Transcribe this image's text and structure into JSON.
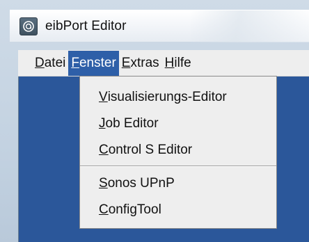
{
  "window": {
    "title": "eibPort Editor",
    "icon": "app-logo-icon"
  },
  "menubar": {
    "items": [
      {
        "mnemonic": "D",
        "rest": "atei"
      },
      {
        "mnemonic": "F",
        "rest": "enster"
      },
      {
        "mnemonic": "E",
        "rest": "xtras"
      },
      {
        "mnemonic": "H",
        "rest": "ilfe"
      }
    ],
    "active": "Fenster"
  },
  "dropdown": {
    "groups": [
      [
        {
          "mnemonic": "V",
          "rest": "isualisierungs-Editor"
        },
        {
          "mnemonic": "J",
          "rest": "ob Editor"
        },
        {
          "mnemonic": "C",
          "rest": "ontrol S Editor"
        }
      ],
      [
        {
          "mnemonic": "S",
          "rest": "onos UPnP"
        },
        {
          "mnemonic": "C",
          "rest": "onfigTool"
        }
      ]
    ]
  },
  "colors": {
    "menu_highlight": "#2e5fa8",
    "menu_background": "#eeeeee",
    "desktop_background": "#2b579a"
  }
}
